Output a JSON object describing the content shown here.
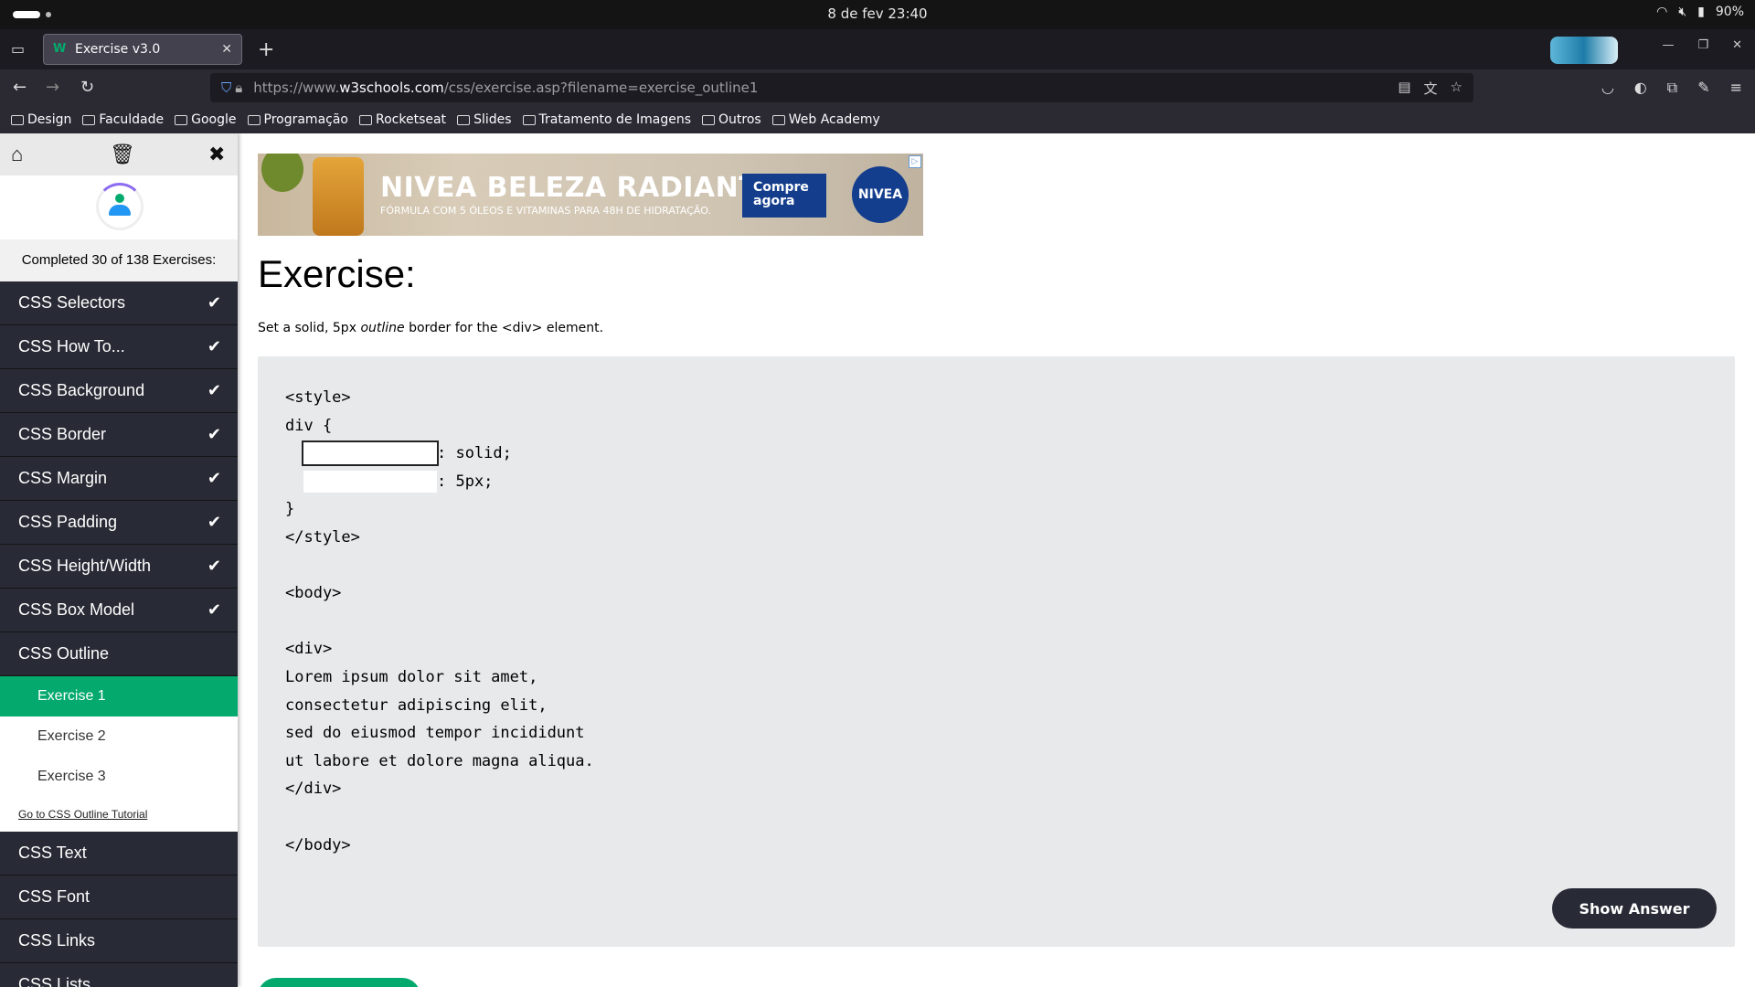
{
  "os": {
    "clock": "8 de fev  23:40",
    "battery": "90%"
  },
  "browser": {
    "tab_title": "Exercise v3.0",
    "url_prefix": "https://www.",
    "url_domain": "w3schools.com",
    "url_path": "/css/exercise.asp?filename=exercise_outline1",
    "bookmarks": [
      "Design",
      "Faculdade",
      "Google",
      "Programação",
      "Rocketseat",
      "Slides",
      "Tratamento de Imagens",
      "Outros",
      "Web Academy"
    ]
  },
  "sidebar": {
    "progress_text": "Completed 30 of 138 Exercises:",
    "items": [
      {
        "label": "CSS Selectors",
        "done": true
      },
      {
        "label": "CSS How To...",
        "done": true
      },
      {
        "label": "CSS Background",
        "done": true
      },
      {
        "label": "CSS Border",
        "done": true
      },
      {
        "label": "CSS Margin",
        "done": true
      },
      {
        "label": "CSS Padding",
        "done": true
      },
      {
        "label": "CSS Height/Width",
        "done": true
      },
      {
        "label": "CSS Box Model",
        "done": true
      },
      {
        "label": "CSS Outline",
        "done": false
      }
    ],
    "exercises": [
      "Exercise 1",
      "Exercise 2",
      "Exercise 3"
    ],
    "tutorial_link": "Go to CSS Outline Tutorial",
    "items_after": [
      "CSS Text",
      "CSS Font",
      "CSS Links",
      "CSS Lists"
    ]
  },
  "ad": {
    "headline": "NIVEA BELEZA RADIANTE",
    "sub": "FÓRMULA COM 5 ÓLEOS E VITAMINAS PARA 48H DE HIDRATAÇÃO.",
    "cta": "Compre agora",
    "logo": "NIVEA"
  },
  "main": {
    "title": "Exercise:",
    "instr_pre": "Set a solid, 5px ",
    "instr_em": "outline",
    "instr_post": " border for the <div> element.",
    "code": {
      "l1": "<style>",
      "l2": "div {",
      "l3_suffix": ": solid;",
      "l4_suffix": ": 5px;",
      "l5": "}",
      "l6": "</style>",
      "l7": "<body>",
      "l8": "<div>",
      "l9": "Lorem ipsum dolor sit amet,",
      "l10": "consectetur adipiscing elit,",
      "l11": "sed do eiusmod tempor incididunt",
      "l12": "ut labore et dolore magna aliqua.",
      "l13": "</div>",
      "l14": "</body>"
    },
    "show_answer": "Show Answer"
  },
  "colors": {
    "accent": "#04aa6d",
    "sidebar_bg": "#282a35",
    "code_bg": "#e7e9eb"
  }
}
